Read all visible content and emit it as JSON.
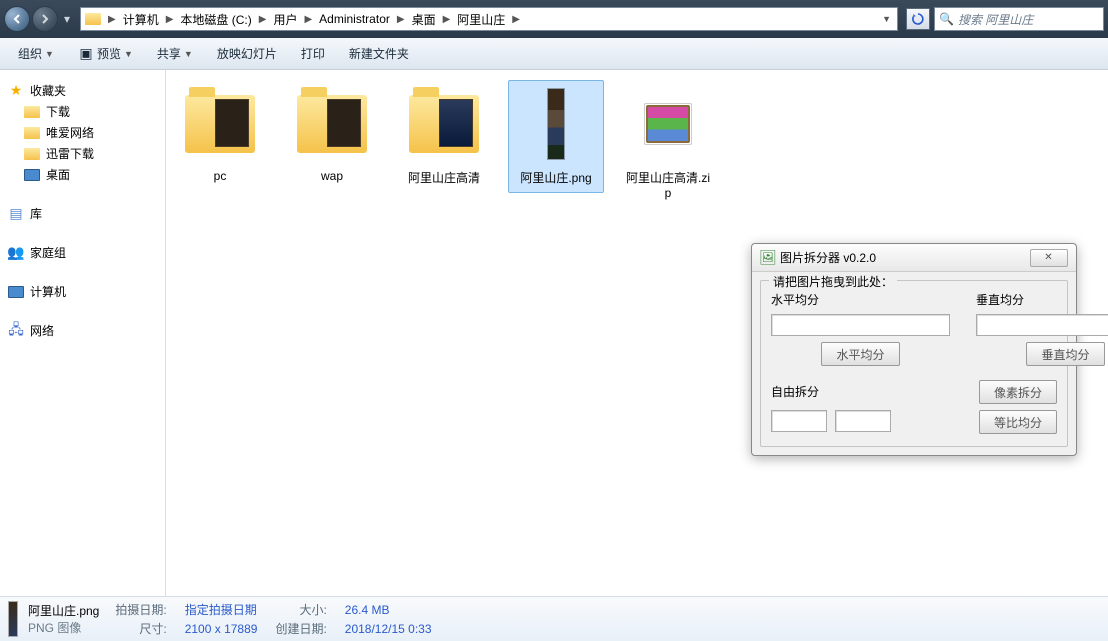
{
  "breadcrumb": {
    "items": [
      "计算机",
      "本地磁盘 (C:)",
      "用户",
      "Administrator",
      "桌面",
      "阿里山庄"
    ]
  },
  "search": {
    "placeholder": "搜索 阿里山庄"
  },
  "toolbar": {
    "organize": "组织",
    "preview": "预览",
    "share": "共享",
    "slideshow": "放映幻灯片",
    "print": "打印",
    "newfolder": "新建文件夹"
  },
  "sidebar": {
    "favorites": {
      "label": "收藏夹"
    },
    "fav_items": [
      {
        "label": "下载"
      },
      {
        "label": "唯爱网络"
      },
      {
        "label": "迅雷下载"
      },
      {
        "label": "桌面"
      }
    ],
    "libraries": {
      "label": "库"
    },
    "homegroup": {
      "label": "家庭组"
    },
    "computer": {
      "label": "计算机"
    },
    "network": {
      "label": "网络"
    }
  },
  "files": [
    {
      "name": "pc",
      "kind": "folder"
    },
    {
      "name": "wap",
      "kind": "folder"
    },
    {
      "name": "阿里山庄高清",
      "kind": "folder"
    },
    {
      "name": "阿里山庄.png",
      "kind": "png",
      "selected": true
    },
    {
      "name": "阿里山庄高清.zip",
      "kind": "rar"
    }
  ],
  "dialog": {
    "title": "图片拆分器 v0.2.0",
    "legend": "请把图片拖曳到此处：",
    "h_label": "水平均分",
    "v_label": "垂直均分",
    "h_btn": "水平均分",
    "v_btn": "垂直均分",
    "free_label": "自由拆分",
    "pixel_btn": "像素拆分",
    "ratio_btn": "等比均分"
  },
  "status": {
    "filename": "阿里山庄.png",
    "filetype": "PNG 图像",
    "shot_label": "拍摄日期:",
    "shot_value": "指定拍摄日期",
    "dim_label": "尺寸:",
    "dim_value": "2100 x 17889",
    "size_label": "大小:",
    "size_value": "26.4 MB",
    "created_label": "创建日期:",
    "created_value": "2018/12/15 0:33"
  }
}
